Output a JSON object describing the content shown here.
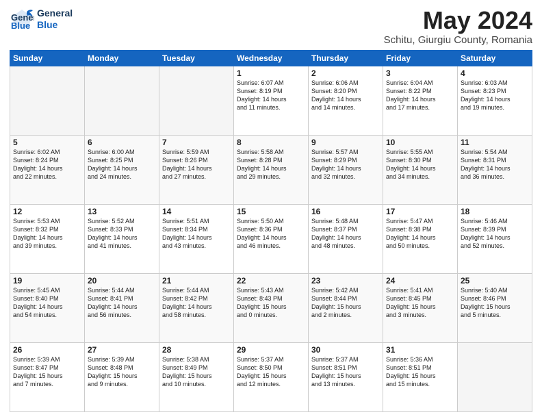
{
  "header": {
    "logo_line1": "General",
    "logo_line2": "Blue",
    "month_year": "May 2024",
    "location": "Schitu, Giurgiu County, Romania"
  },
  "weekdays": [
    "Sunday",
    "Monday",
    "Tuesday",
    "Wednesday",
    "Thursday",
    "Friday",
    "Saturday"
  ],
  "weeks": [
    [
      {
        "day": "",
        "info": ""
      },
      {
        "day": "",
        "info": ""
      },
      {
        "day": "",
        "info": ""
      },
      {
        "day": "1",
        "info": "Sunrise: 6:07 AM\nSunset: 8:19 PM\nDaylight: 14 hours\nand 11 minutes."
      },
      {
        "day": "2",
        "info": "Sunrise: 6:06 AM\nSunset: 8:20 PM\nDaylight: 14 hours\nand 14 minutes."
      },
      {
        "day": "3",
        "info": "Sunrise: 6:04 AM\nSunset: 8:22 PM\nDaylight: 14 hours\nand 17 minutes."
      },
      {
        "day": "4",
        "info": "Sunrise: 6:03 AM\nSunset: 8:23 PM\nDaylight: 14 hours\nand 19 minutes."
      }
    ],
    [
      {
        "day": "5",
        "info": "Sunrise: 6:02 AM\nSunset: 8:24 PM\nDaylight: 14 hours\nand 22 minutes."
      },
      {
        "day": "6",
        "info": "Sunrise: 6:00 AM\nSunset: 8:25 PM\nDaylight: 14 hours\nand 24 minutes."
      },
      {
        "day": "7",
        "info": "Sunrise: 5:59 AM\nSunset: 8:26 PM\nDaylight: 14 hours\nand 27 minutes."
      },
      {
        "day": "8",
        "info": "Sunrise: 5:58 AM\nSunset: 8:28 PM\nDaylight: 14 hours\nand 29 minutes."
      },
      {
        "day": "9",
        "info": "Sunrise: 5:57 AM\nSunset: 8:29 PM\nDaylight: 14 hours\nand 32 minutes."
      },
      {
        "day": "10",
        "info": "Sunrise: 5:55 AM\nSunset: 8:30 PM\nDaylight: 14 hours\nand 34 minutes."
      },
      {
        "day": "11",
        "info": "Sunrise: 5:54 AM\nSunset: 8:31 PM\nDaylight: 14 hours\nand 36 minutes."
      }
    ],
    [
      {
        "day": "12",
        "info": "Sunrise: 5:53 AM\nSunset: 8:32 PM\nDaylight: 14 hours\nand 39 minutes."
      },
      {
        "day": "13",
        "info": "Sunrise: 5:52 AM\nSunset: 8:33 PM\nDaylight: 14 hours\nand 41 minutes."
      },
      {
        "day": "14",
        "info": "Sunrise: 5:51 AM\nSunset: 8:34 PM\nDaylight: 14 hours\nand 43 minutes."
      },
      {
        "day": "15",
        "info": "Sunrise: 5:50 AM\nSunset: 8:36 PM\nDaylight: 14 hours\nand 46 minutes."
      },
      {
        "day": "16",
        "info": "Sunrise: 5:48 AM\nSunset: 8:37 PM\nDaylight: 14 hours\nand 48 minutes."
      },
      {
        "day": "17",
        "info": "Sunrise: 5:47 AM\nSunset: 8:38 PM\nDaylight: 14 hours\nand 50 minutes."
      },
      {
        "day": "18",
        "info": "Sunrise: 5:46 AM\nSunset: 8:39 PM\nDaylight: 14 hours\nand 52 minutes."
      }
    ],
    [
      {
        "day": "19",
        "info": "Sunrise: 5:45 AM\nSunset: 8:40 PM\nDaylight: 14 hours\nand 54 minutes."
      },
      {
        "day": "20",
        "info": "Sunrise: 5:44 AM\nSunset: 8:41 PM\nDaylight: 14 hours\nand 56 minutes."
      },
      {
        "day": "21",
        "info": "Sunrise: 5:44 AM\nSunset: 8:42 PM\nDaylight: 14 hours\nand 58 minutes."
      },
      {
        "day": "22",
        "info": "Sunrise: 5:43 AM\nSunset: 8:43 PM\nDaylight: 15 hours\nand 0 minutes."
      },
      {
        "day": "23",
        "info": "Sunrise: 5:42 AM\nSunset: 8:44 PM\nDaylight: 15 hours\nand 2 minutes."
      },
      {
        "day": "24",
        "info": "Sunrise: 5:41 AM\nSunset: 8:45 PM\nDaylight: 15 hours\nand 3 minutes."
      },
      {
        "day": "25",
        "info": "Sunrise: 5:40 AM\nSunset: 8:46 PM\nDaylight: 15 hours\nand 5 minutes."
      }
    ],
    [
      {
        "day": "26",
        "info": "Sunrise: 5:39 AM\nSunset: 8:47 PM\nDaylight: 15 hours\nand 7 minutes."
      },
      {
        "day": "27",
        "info": "Sunrise: 5:39 AM\nSunset: 8:48 PM\nDaylight: 15 hours\nand 9 minutes."
      },
      {
        "day": "28",
        "info": "Sunrise: 5:38 AM\nSunset: 8:49 PM\nDaylight: 15 hours\nand 10 minutes."
      },
      {
        "day": "29",
        "info": "Sunrise: 5:37 AM\nSunset: 8:50 PM\nDaylight: 15 hours\nand 12 minutes."
      },
      {
        "day": "30",
        "info": "Sunrise: 5:37 AM\nSunset: 8:51 PM\nDaylight: 15 hours\nand 13 minutes."
      },
      {
        "day": "31",
        "info": "Sunrise: 5:36 AM\nSunset: 8:51 PM\nDaylight: 15 hours\nand 15 minutes."
      },
      {
        "day": "",
        "info": ""
      }
    ]
  ]
}
